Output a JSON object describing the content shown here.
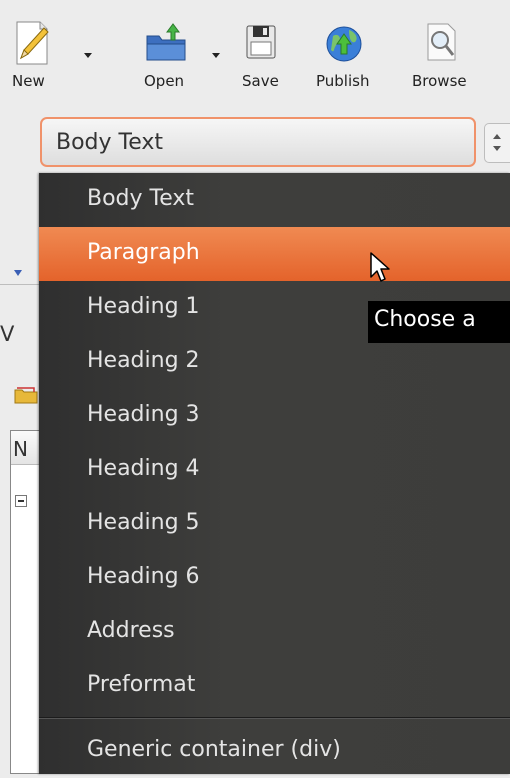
{
  "toolbar": {
    "new_label": "New",
    "open_label": "Open",
    "save_label": "Save",
    "publish_label": "Publish",
    "browse_label": "Browse"
  },
  "format_select": {
    "value": "Body Text",
    "options": [
      "Body Text",
      "Paragraph",
      "Heading 1",
      "Heading 2",
      "Heading 3",
      "Heading 4",
      "Heading 5",
      "Heading 6",
      "Address",
      "Preformat",
      "Generic container (div)"
    ],
    "highlighted": "Paragraph"
  },
  "background": {
    "panel_letter": "V",
    "list_header": "N"
  },
  "tooltip": {
    "text": "Choose a"
  },
  "colors": {
    "accent": "#e4632b",
    "dropdown_bg": "#3d3d3b",
    "focus_border": "#f0926a"
  },
  "icons": [
    "pencil-page-icon",
    "folder-open-icon",
    "floppy-disk-icon",
    "globe-publish-icon",
    "magnifier-page-icon",
    "mouse-pointer-icon"
  ]
}
